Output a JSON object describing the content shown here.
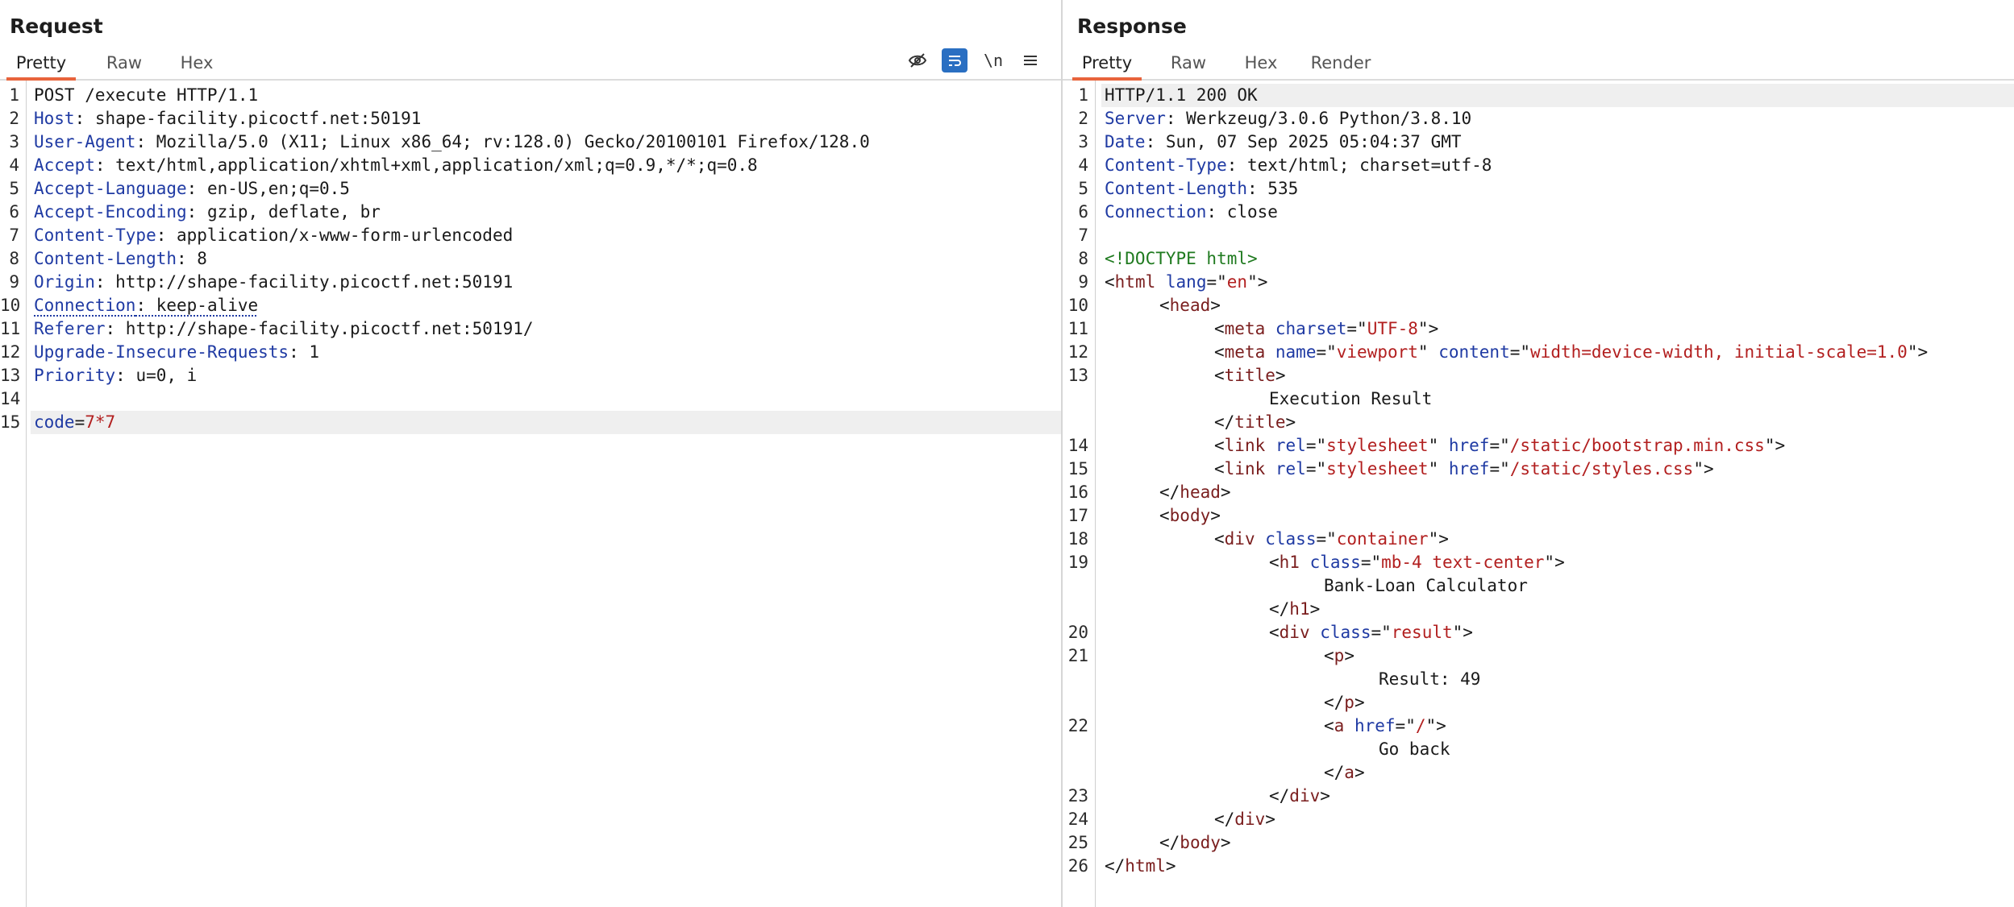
{
  "request": {
    "title": "Request",
    "tabs": [
      "Pretty",
      "Raw",
      "Hex"
    ],
    "toolbar": {
      "hide_icon": "eye-slash-icon",
      "wrap_icon": "word-wrap-icon",
      "newline_label": "\\n",
      "menu_icon": "hamburger-menu-icon"
    },
    "lines": [
      {
        "n": "1",
        "parts": [
          {
            "t": "POST /execute HTTP/1.1",
            "c": ""
          }
        ]
      },
      {
        "n": "2",
        "parts": [
          {
            "t": "Host",
            "c": "k"
          },
          {
            "t": ": shape-facility.picoctf.net:50191",
            "c": ""
          }
        ]
      },
      {
        "n": "3",
        "parts": [
          {
            "t": "User-Agent",
            "c": "k"
          },
          {
            "t": ": Mozilla/5.0 (X11; Linux x86_64; rv:128.0) Gecko/20100101 Firefox/128.0",
            "c": ""
          }
        ]
      },
      {
        "n": "4",
        "parts": [
          {
            "t": "Accept",
            "c": "k"
          },
          {
            "t": ": text/html,application/xhtml+xml,application/xml;q=0.9,*/*;q=0.8",
            "c": ""
          }
        ]
      },
      {
        "n": "5",
        "parts": [
          {
            "t": "Accept-Language",
            "c": "k"
          },
          {
            "t": ": en-US,en;q=0.5",
            "c": ""
          }
        ]
      },
      {
        "n": "6",
        "parts": [
          {
            "t": "Accept-Encoding",
            "c": "k"
          },
          {
            "t": ": gzip, deflate, br",
            "c": ""
          }
        ]
      },
      {
        "n": "7",
        "parts": [
          {
            "t": "Content-Type",
            "c": "k"
          },
          {
            "t": ": application/x-www-form-urlencoded",
            "c": ""
          }
        ]
      },
      {
        "n": "8",
        "parts": [
          {
            "t": "Content-Length",
            "c": "k"
          },
          {
            "t": ": 8",
            "c": ""
          }
        ]
      },
      {
        "n": "9",
        "parts": [
          {
            "t": "Origin",
            "c": "k"
          },
          {
            "t": ": http://shape-facility.picoctf.net:50191",
            "c": ""
          }
        ]
      },
      {
        "n": "10",
        "parts": [
          {
            "t": "Connection",
            "c": "k dotted"
          },
          {
            "t": ": keep-alive",
            "c": "dotted"
          }
        ]
      },
      {
        "n": "11",
        "parts": [
          {
            "t": "Referer",
            "c": "k"
          },
          {
            "t": ": http://shape-facility.picoctf.net:50191/",
            "c": ""
          }
        ]
      },
      {
        "n": "12",
        "parts": [
          {
            "t": "Upgrade-Insecure-Requests",
            "c": "k"
          },
          {
            "t": ": 1",
            "c": ""
          }
        ]
      },
      {
        "n": "13",
        "parts": [
          {
            "t": "Priority",
            "c": "k"
          },
          {
            "t": ": u=0, i",
            "c": ""
          }
        ]
      },
      {
        "n": "14",
        "parts": []
      },
      {
        "n": "15",
        "hl": true,
        "parts": [
          {
            "t": "code",
            "c": "k"
          },
          {
            "t": "=",
            "c": ""
          },
          {
            "t": "7*7",
            "c": "val"
          }
        ]
      }
    ]
  },
  "response": {
    "title": "Response",
    "tabs": [
      "Pretty",
      "Raw",
      "Hex",
      "Render"
    ],
    "lines": [
      {
        "n": "1",
        "hl": true,
        "parts": [
          {
            "t": "HTTP/1.1 200 OK",
            "c": ""
          }
        ]
      },
      {
        "n": "2",
        "parts": [
          {
            "t": "Server",
            "c": "k"
          },
          {
            "t": ": Werkzeug/3.0.6 Python/3.8.10",
            "c": ""
          }
        ]
      },
      {
        "n": "3",
        "parts": [
          {
            "t": "Date",
            "c": "k"
          },
          {
            "t": ": Sun, 07 Sep 2025 05:04:37 GMT",
            "c": ""
          }
        ]
      },
      {
        "n": "4",
        "parts": [
          {
            "t": "Content-Type",
            "c": "k"
          },
          {
            "t": ": text/html; charset=utf-8",
            "c": ""
          }
        ]
      },
      {
        "n": "5",
        "parts": [
          {
            "t": "Content-Length",
            "c": "k"
          },
          {
            "t": ": 535",
            "c": ""
          }
        ]
      },
      {
        "n": "6",
        "parts": [
          {
            "t": "Connection",
            "c": "k"
          },
          {
            "t": ": close",
            "c": ""
          }
        ]
      },
      {
        "n": "7",
        "parts": []
      },
      {
        "n": "8",
        "parts": [
          {
            "t": "<!DOCTYPE html>",
            "c": "doc"
          }
        ]
      },
      {
        "n": "9",
        "parts": [
          {
            "t": "<",
            "c": ""
          },
          {
            "t": "html",
            "c": "tag"
          },
          {
            "t": " ",
            "c": ""
          },
          {
            "t": "lang",
            "c": "attr"
          },
          {
            "t": "=\"",
            "c": ""
          },
          {
            "t": "en",
            "c": "val"
          },
          {
            "t": "\">",
            "c": ""
          }
        ]
      },
      {
        "n": "10",
        "indent": 1,
        "parts": [
          {
            "t": "<",
            "c": ""
          },
          {
            "t": "head",
            "c": "tag"
          },
          {
            "t": ">",
            "c": ""
          }
        ]
      },
      {
        "n": "11",
        "indent": 2,
        "parts": [
          {
            "t": "<",
            "c": ""
          },
          {
            "t": "meta",
            "c": "tag"
          },
          {
            "t": " ",
            "c": ""
          },
          {
            "t": "charset",
            "c": "attr"
          },
          {
            "t": "=\"",
            "c": ""
          },
          {
            "t": "UTF-8",
            "c": "val"
          },
          {
            "t": "\">",
            "c": ""
          }
        ]
      },
      {
        "n": "12",
        "indent": 2,
        "parts": [
          {
            "t": "<",
            "c": ""
          },
          {
            "t": "meta",
            "c": "tag"
          },
          {
            "t": " ",
            "c": ""
          },
          {
            "t": "name",
            "c": "attr"
          },
          {
            "t": "=\"",
            "c": ""
          },
          {
            "t": "viewport",
            "c": "val"
          },
          {
            "t": "\" ",
            "c": ""
          },
          {
            "t": "content",
            "c": "attr"
          },
          {
            "t": "=\"",
            "c": ""
          },
          {
            "t": "width=device-width, initial-scale=1.0",
            "c": "val"
          },
          {
            "t": "\">",
            "c": ""
          }
        ]
      },
      {
        "n": "13",
        "indent": 2,
        "parts": [
          {
            "t": "<",
            "c": ""
          },
          {
            "t": "title",
            "c": "tag"
          },
          {
            "t": ">",
            "c": ""
          }
        ]
      },
      {
        "n": "",
        "indent": 3,
        "parts": [
          {
            "t": "Execution Result",
            "c": ""
          }
        ]
      },
      {
        "n": "",
        "indent": 2,
        "parts": [
          {
            "t": "</",
            "c": ""
          },
          {
            "t": "title",
            "c": "tag"
          },
          {
            "t": ">",
            "c": ""
          }
        ]
      },
      {
        "n": "14",
        "indent": 2,
        "parts": [
          {
            "t": "<",
            "c": ""
          },
          {
            "t": "link",
            "c": "tag"
          },
          {
            "t": " ",
            "c": ""
          },
          {
            "t": "rel",
            "c": "attr"
          },
          {
            "t": "=\"",
            "c": ""
          },
          {
            "t": "stylesheet",
            "c": "val"
          },
          {
            "t": "\" ",
            "c": ""
          },
          {
            "t": "href",
            "c": "attr"
          },
          {
            "t": "=\"",
            "c": ""
          },
          {
            "t": "/static/bootstrap.min.css",
            "c": "val"
          },
          {
            "t": "\">",
            "c": ""
          }
        ]
      },
      {
        "n": "15",
        "indent": 2,
        "parts": [
          {
            "t": "<",
            "c": ""
          },
          {
            "t": "link",
            "c": "tag"
          },
          {
            "t": " ",
            "c": ""
          },
          {
            "t": "rel",
            "c": "attr"
          },
          {
            "t": "=\"",
            "c": ""
          },
          {
            "t": "stylesheet",
            "c": "val"
          },
          {
            "t": "\" ",
            "c": ""
          },
          {
            "t": "href",
            "c": "attr"
          },
          {
            "t": "=\"",
            "c": ""
          },
          {
            "t": "/static/styles.css",
            "c": "val"
          },
          {
            "t": "\">",
            "c": ""
          }
        ]
      },
      {
        "n": "16",
        "indent": 1,
        "parts": [
          {
            "t": "</",
            "c": ""
          },
          {
            "t": "head",
            "c": "tag"
          },
          {
            "t": ">",
            "c": ""
          }
        ]
      },
      {
        "n": "17",
        "indent": 1,
        "parts": [
          {
            "t": "<",
            "c": ""
          },
          {
            "t": "body",
            "c": "tag"
          },
          {
            "t": ">",
            "c": ""
          }
        ]
      },
      {
        "n": "18",
        "indent": 2,
        "parts": [
          {
            "t": "<",
            "c": ""
          },
          {
            "t": "div",
            "c": "tag"
          },
          {
            "t": " ",
            "c": ""
          },
          {
            "t": "class",
            "c": "attr"
          },
          {
            "t": "=\"",
            "c": ""
          },
          {
            "t": "container",
            "c": "val"
          },
          {
            "t": "\">",
            "c": ""
          }
        ]
      },
      {
        "n": "19",
        "indent": 3,
        "parts": [
          {
            "t": "<",
            "c": ""
          },
          {
            "t": "h1",
            "c": "tag"
          },
          {
            "t": " ",
            "c": ""
          },
          {
            "t": "class",
            "c": "attr"
          },
          {
            "t": "=\"",
            "c": ""
          },
          {
            "t": "mb-4 text-center",
            "c": "val"
          },
          {
            "t": "\">",
            "c": ""
          }
        ]
      },
      {
        "n": "",
        "indent": 4,
        "parts": [
          {
            "t": "Bank-Loan Calculator",
            "c": ""
          }
        ]
      },
      {
        "n": "",
        "indent": 3,
        "parts": [
          {
            "t": "</",
            "c": ""
          },
          {
            "t": "h1",
            "c": "tag"
          },
          {
            "t": ">",
            "c": ""
          }
        ]
      },
      {
        "n": "20",
        "indent": 3,
        "parts": [
          {
            "t": "<",
            "c": ""
          },
          {
            "t": "div",
            "c": "tag"
          },
          {
            "t": " ",
            "c": ""
          },
          {
            "t": "class",
            "c": "attr"
          },
          {
            "t": "=\"",
            "c": ""
          },
          {
            "t": "result",
            "c": "val"
          },
          {
            "t": "\">",
            "c": ""
          }
        ]
      },
      {
        "n": "21",
        "indent": 4,
        "parts": [
          {
            "t": "<",
            "c": ""
          },
          {
            "t": "p",
            "c": "tag"
          },
          {
            "t": ">",
            "c": ""
          }
        ]
      },
      {
        "n": "",
        "indent": 5,
        "parts": [
          {
            "t": "Result: 49",
            "c": ""
          }
        ]
      },
      {
        "n": "",
        "indent": 4,
        "parts": [
          {
            "t": "</",
            "c": ""
          },
          {
            "t": "p",
            "c": "tag"
          },
          {
            "t": ">",
            "c": ""
          }
        ]
      },
      {
        "n": "22",
        "indent": 4,
        "parts": [
          {
            "t": "<",
            "c": ""
          },
          {
            "t": "a",
            "c": "tag"
          },
          {
            "t": " ",
            "c": ""
          },
          {
            "t": "href",
            "c": "attr"
          },
          {
            "t": "=\"",
            "c": ""
          },
          {
            "t": "/",
            "c": "val"
          },
          {
            "t": "\">",
            "c": ""
          }
        ]
      },
      {
        "n": "",
        "indent": 5,
        "parts": [
          {
            "t": "Go back",
            "c": ""
          }
        ]
      },
      {
        "n": "",
        "indent": 4,
        "parts": [
          {
            "t": "</",
            "c": ""
          },
          {
            "t": "a",
            "c": "tag"
          },
          {
            "t": ">",
            "c": ""
          }
        ]
      },
      {
        "n": "23",
        "indent": 3,
        "parts": [
          {
            "t": "</",
            "c": ""
          },
          {
            "t": "div",
            "c": "tag"
          },
          {
            "t": ">",
            "c": ""
          }
        ]
      },
      {
        "n": "24",
        "indent": 2,
        "parts": [
          {
            "t": "</",
            "c": ""
          },
          {
            "t": "div",
            "c": "tag"
          },
          {
            "t": ">",
            "c": ""
          }
        ]
      },
      {
        "n": "25",
        "indent": 1,
        "parts": [
          {
            "t": "</",
            "c": ""
          },
          {
            "t": "body",
            "c": "tag"
          },
          {
            "t": ">",
            "c": ""
          }
        ]
      },
      {
        "n": "26",
        "parts": [
          {
            "t": "</",
            "c": ""
          },
          {
            "t": "html",
            "c": "tag"
          },
          {
            "t": ">",
            "c": ""
          }
        ]
      }
    ]
  }
}
